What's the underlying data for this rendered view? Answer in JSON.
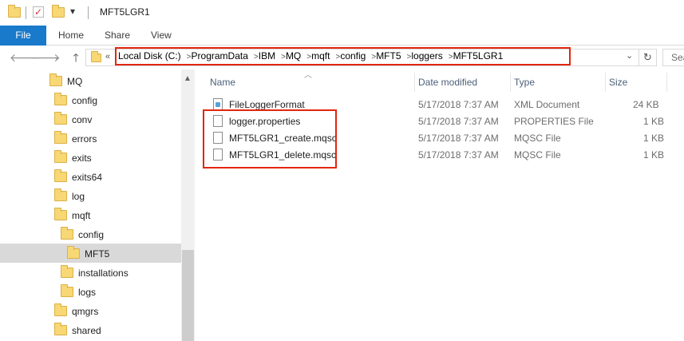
{
  "window": {
    "title": "MFT5LGR1",
    "quick_access_dropdown": "▾"
  },
  "ribbon": {
    "tabs": [
      "File",
      "Home",
      "Share",
      "View"
    ]
  },
  "address": {
    "crumbs": [
      "Local Disk (C:)",
      "ProgramData",
      "IBM",
      "MQ",
      "mqft",
      "config",
      "MFT5",
      "loggers",
      "MFT5LGR1"
    ],
    "overflow": "«",
    "search_placeholder": "Sea"
  },
  "nav": {
    "items": [
      {
        "label": "MQ",
        "level": 0
      },
      {
        "label": "config",
        "level": 1
      },
      {
        "label": "conv",
        "level": 1
      },
      {
        "label": "errors",
        "level": 1
      },
      {
        "label": "exits",
        "level": 1
      },
      {
        "label": "exits64",
        "level": 1
      },
      {
        "label": "log",
        "level": 1
      },
      {
        "label": "mqft",
        "level": 1
      },
      {
        "label": "config",
        "level": 2
      },
      {
        "label": "MFT5",
        "level": 3,
        "selected": true
      },
      {
        "label": "installations",
        "level": 2
      },
      {
        "label": "logs",
        "level": 2
      },
      {
        "label": "qmgrs",
        "level": 1
      },
      {
        "label": "shared",
        "level": 1
      }
    ]
  },
  "columns": {
    "name": "Name",
    "date": "Date modified",
    "type": "Type",
    "size": "Size"
  },
  "files": [
    {
      "name": "FileLoggerFormat",
      "date": "5/17/2018 7:37 AM",
      "type": "XML Document",
      "size": "24 KB",
      "icon": "xml-document-icon"
    },
    {
      "name": "logger.properties",
      "date": "5/17/2018 7:37 AM",
      "type": "PROPERTIES File",
      "size": "1 KB",
      "icon": "file-icon"
    },
    {
      "name": "MFT5LGR1_create.mqsc",
      "date": "5/17/2018 7:37 AM",
      "type": "MQSC File",
      "size": "1 KB",
      "icon": "file-icon"
    },
    {
      "name": "MFT5LGR1_delete.mqsc",
      "date": "5/17/2018 7:37 AM",
      "type": "MQSC File",
      "size": "1 KB",
      "icon": "file-icon"
    }
  ],
  "colors": {
    "accent": "#1979ca",
    "highlight": "#e3260f",
    "folder": "#f8d775"
  }
}
